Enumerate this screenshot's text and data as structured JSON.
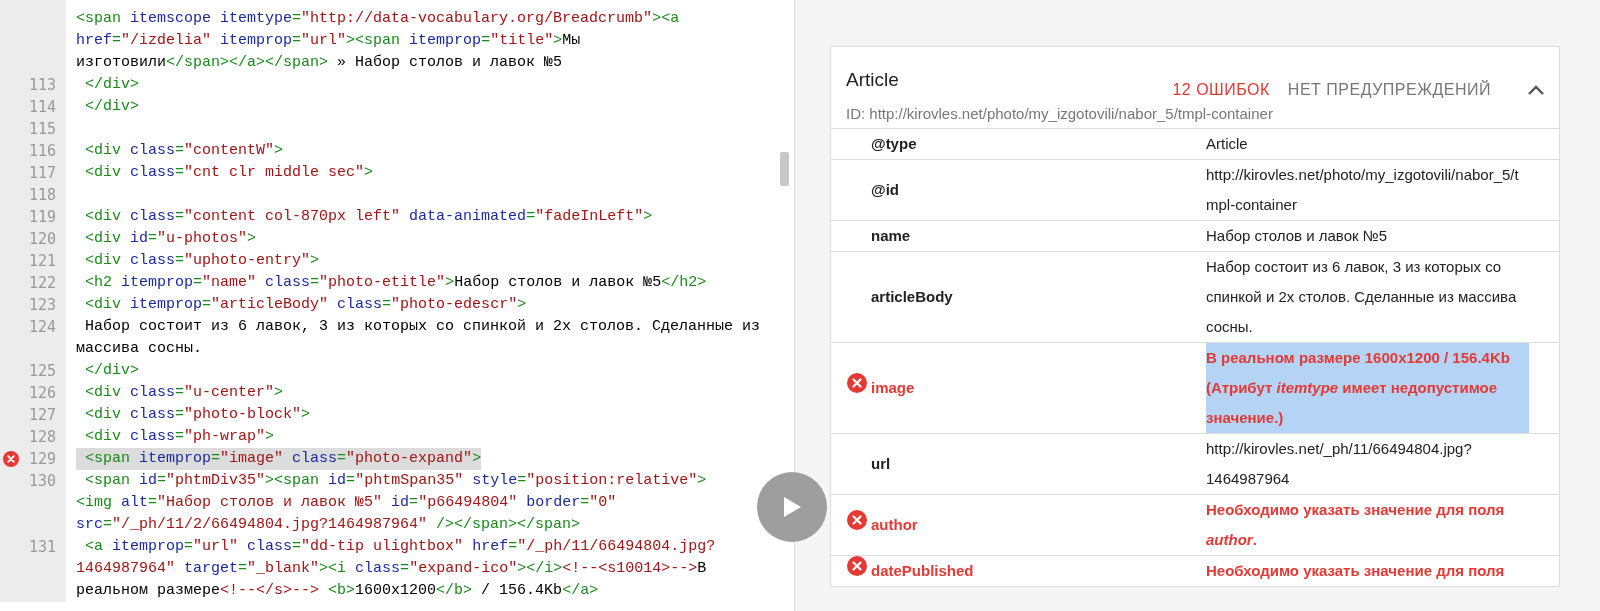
{
  "code": {
    "lines": [
      {
        "error": false,
        "highlighted": false,
        "rows": [
          {
            "segments": [
              {
                "kind": "tag",
                "text": "<span "
              },
              {
                "kind": "attr",
                "text": "itemscope itemtype"
              },
              {
                "kind": "tag",
                "text": "="
              },
              {
                "kind": "val",
                "text": "\"http://data-vocabulary.org/Breadcrumb\""
              },
              {
                "kind": "tag",
                "text": "><a"
              }
            ]
          },
          {
            "segments": [
              {
                "kind": "attr",
                "text": "href"
              },
              {
                "kind": "tag",
                "text": "="
              },
              {
                "kind": "val",
                "text": "\"/izdelia\""
              },
              {
                "kind": "attr",
                "text": " itemprop"
              },
              {
                "kind": "tag",
                "text": "="
              },
              {
                "kind": "val",
                "text": "\"url\""
              },
              {
                "kind": "tag",
                "text": "><span "
              },
              {
                "kind": "attr",
                "text": "itemprop"
              },
              {
                "kind": "tag",
                "text": "="
              },
              {
                "kind": "val",
                "text": "\"title\""
              },
              {
                "kind": "tag",
                "text": ">"
              },
              {
                "kind": "text",
                "text": "Мы"
              }
            ]
          },
          {
            "segments": [
              {
                "kind": "text",
                "text": "изготовили"
              },
              {
                "kind": "tag",
                "text": "</span></a></span>"
              },
              {
                "kind": "text",
                "text": " » Набор столов и лавок №5"
              }
            ]
          }
        ]
      },
      {
        "number": "113",
        "error": false,
        "highlighted": false,
        "rows": [
          {
            "segments": [
              {
                "kind": "tag",
                "text": " </div>"
              }
            ]
          }
        ]
      },
      {
        "number": "114",
        "error": false,
        "highlighted": false,
        "rows": [
          {
            "segments": [
              {
                "kind": "tag",
                "text": " </div>"
              }
            ]
          }
        ]
      },
      {
        "number": "115",
        "error": false,
        "rows": [
          {
            "segments": []
          }
        ]
      },
      {
        "number": "116",
        "error": false,
        "highlighted": false,
        "rows": [
          {
            "segments": [
              {
                "kind": "tag",
                "text": " <div "
              },
              {
                "kind": "attr",
                "text": "class"
              },
              {
                "kind": "tag",
                "text": "="
              },
              {
                "kind": "val",
                "text": "\"contentW\""
              },
              {
                "kind": "tag",
                "text": ">"
              }
            ]
          }
        ]
      },
      {
        "number": "117",
        "error": false,
        "highlighted": false,
        "rows": [
          {
            "segments": [
              {
                "kind": "tag",
                "text": " <div "
              },
              {
                "kind": "attr",
                "text": "class"
              },
              {
                "kind": "tag",
                "text": "="
              },
              {
                "kind": "val",
                "text": "\"cnt clr middle sec\""
              },
              {
                "kind": "tag",
                "text": ">"
              }
            ]
          }
        ]
      },
      {
        "number": "118",
        "error": false,
        "rows": [
          {
            "segments": []
          }
        ]
      },
      {
        "number": "119",
        "error": false,
        "highlighted": false,
        "rows": [
          {
            "segments": [
              {
                "kind": "tag",
                "text": " <div "
              },
              {
                "kind": "attr",
                "text": "class"
              },
              {
                "kind": "tag",
                "text": "="
              },
              {
                "kind": "val",
                "text": "\"content col-870px left\""
              },
              {
                "kind": "attr",
                "text": " data-animated"
              },
              {
                "kind": "tag",
                "text": "="
              },
              {
                "kind": "val",
                "text": "\"fadeInLeft\""
              },
              {
                "kind": "tag",
                "text": ">"
              }
            ]
          }
        ]
      },
      {
        "number": "120",
        "error": false,
        "highlighted": false,
        "rows": [
          {
            "segments": [
              {
                "kind": "tag",
                "text": " <div "
              },
              {
                "kind": "attr",
                "text": "id"
              },
              {
                "kind": "tag",
                "text": "="
              },
              {
                "kind": "val",
                "text": "\"u-photos\""
              },
              {
                "kind": "tag",
                "text": ">"
              }
            ]
          }
        ]
      },
      {
        "number": "121",
        "error": false,
        "highlighted": false,
        "rows": [
          {
            "segments": [
              {
                "kind": "tag",
                "text": " <div "
              },
              {
                "kind": "attr",
                "text": "class"
              },
              {
                "kind": "tag",
                "text": "="
              },
              {
                "kind": "val",
                "text": "\"uphoto-entry\""
              },
              {
                "kind": "tag",
                "text": ">"
              }
            ]
          }
        ]
      },
      {
        "number": "122",
        "error": false,
        "highlighted": false,
        "rows": [
          {
            "segments": [
              {
                "kind": "tag",
                "text": " <h2 "
              },
              {
                "kind": "attr",
                "text": "itemprop"
              },
              {
                "kind": "tag",
                "text": "="
              },
              {
                "kind": "val",
                "text": "\"name\""
              },
              {
                "kind": "attr",
                "text": " class"
              },
              {
                "kind": "tag",
                "text": "="
              },
              {
                "kind": "val",
                "text": "\"photo-etitle\""
              },
              {
                "kind": "tag",
                "text": ">"
              },
              {
                "kind": "text",
                "text": "Набор столов и лавок №5"
              },
              {
                "kind": "tag",
                "text": "</h2>"
              }
            ]
          }
        ]
      },
      {
        "number": "123",
        "error": false,
        "highlighted": false,
        "rows": [
          {
            "segments": [
              {
                "kind": "tag",
                "text": " <div "
              },
              {
                "kind": "attr",
                "text": "itemprop"
              },
              {
                "kind": "tag",
                "text": "="
              },
              {
                "kind": "val",
                "text": "\"articleBody\""
              },
              {
                "kind": "attr",
                "text": " class"
              },
              {
                "kind": "tag",
                "text": "="
              },
              {
                "kind": "val",
                "text": "\"photo-edescr\""
              },
              {
                "kind": "tag",
                "text": ">"
              }
            ]
          }
        ]
      },
      {
        "number": "124",
        "error": false,
        "highlighted": false,
        "rows": [
          {
            "segments": [
              {
                "kind": "text",
                "text": " Набор состоит из 6 лавок, 3 из которых со спинкой и 2х столов. Сделанные из"
              }
            ]
          },
          {
            "segments": [
              {
                "kind": "text",
                "text": "массива сосны."
              }
            ]
          }
        ]
      },
      {
        "number": "125",
        "error": false,
        "highlighted": false,
        "rows": [
          {
            "segments": [
              {
                "kind": "tag",
                "text": " </div>"
              }
            ]
          }
        ]
      },
      {
        "number": "126",
        "error": false,
        "highlighted": false,
        "rows": [
          {
            "segments": [
              {
                "kind": "tag",
                "text": " <div "
              },
              {
                "kind": "attr",
                "text": "class"
              },
              {
                "kind": "tag",
                "text": "="
              },
              {
                "kind": "val",
                "text": "\"u-center\""
              },
              {
                "kind": "tag",
                "text": ">"
              }
            ]
          }
        ]
      },
      {
        "number": "127",
        "error": false,
        "highlighted": false,
        "rows": [
          {
            "segments": [
              {
                "kind": "tag",
                "text": " <div "
              },
              {
                "kind": "attr",
                "text": "class"
              },
              {
                "kind": "tag",
                "text": "="
              },
              {
                "kind": "val",
                "text": "\"photo-block\""
              },
              {
                "kind": "tag",
                "text": ">"
              }
            ]
          }
        ]
      },
      {
        "number": "128",
        "error": false,
        "highlighted": false,
        "rows": [
          {
            "segments": [
              {
                "kind": "tag",
                "text": " <div "
              },
              {
                "kind": "attr",
                "text": "class"
              },
              {
                "kind": "tag",
                "text": "="
              },
              {
                "kind": "val",
                "text": "\"ph-wrap\""
              },
              {
                "kind": "tag",
                "text": ">"
              }
            ]
          }
        ]
      },
      {
        "number": "129",
        "error": true,
        "highlighted": true,
        "rows": [
          {
            "segments": [
              {
                "kind": "tag",
                "text": " <span "
              },
              {
                "kind": "attr",
                "text": "itemprop"
              },
              {
                "kind": "tag",
                "text": "="
              },
              {
                "kind": "val",
                "text": "\"image\""
              },
              {
                "kind": "attr",
                "text": " class"
              },
              {
                "kind": "tag",
                "text": "="
              },
              {
                "kind": "val",
                "text": "\"photo-expand\""
              },
              {
                "kind": "tag",
                "text": ">"
              }
            ]
          }
        ]
      },
      {
        "number": "130",
        "error": false,
        "highlighted": false,
        "rows": [
          {
            "segments": [
              {
                "kind": "tag",
                "text": " <span "
              },
              {
                "kind": "attr",
                "text": "id"
              },
              {
                "kind": "tag",
                "text": "="
              },
              {
                "kind": "val",
                "text": "\"phtmDiv35\""
              },
              {
                "kind": "tag",
                "text": "><span "
              },
              {
                "kind": "attr",
                "text": "id"
              },
              {
                "kind": "tag",
                "text": "="
              },
              {
                "kind": "val",
                "text": "\"phtmSpan35\""
              },
              {
                "kind": "attr",
                "text": " style"
              },
              {
                "kind": "tag",
                "text": "="
              },
              {
                "kind": "val",
                "text": "\"position:relative\""
              },
              {
                "kind": "tag",
                "text": ">"
              }
            ]
          },
          {
            "segments": [
              {
                "kind": "tag",
                "text": "<img "
              },
              {
                "kind": "attr",
                "text": "alt"
              },
              {
                "kind": "tag",
                "text": "="
              },
              {
                "kind": "val",
                "text": "\"Набор столов и лавок №5\""
              },
              {
                "kind": "attr",
                "text": " id"
              },
              {
                "kind": "tag",
                "text": "="
              },
              {
                "kind": "val",
                "text": "\"p66494804\""
              },
              {
                "kind": "attr",
                "text": " border"
              },
              {
                "kind": "tag",
                "text": "="
              },
              {
                "kind": "val",
                "text": "\"0\""
              }
            ]
          },
          {
            "segments": [
              {
                "kind": "attr",
                "text": "src"
              },
              {
                "kind": "tag",
                "text": "="
              },
              {
                "kind": "val",
                "text": "\"/_ph/11/2/66494804.jpg?1464987964\""
              },
              {
                "kind": "tag",
                "text": " /></span></span>"
              }
            ]
          }
        ]
      },
      {
        "number": "131",
        "error": false,
        "highlighted": false,
        "rows": [
          {
            "segments": [
              {
                "kind": "tag",
                "text": " <a "
              },
              {
                "kind": "attr",
                "text": "itemprop"
              },
              {
                "kind": "tag",
                "text": "="
              },
              {
                "kind": "val",
                "text": "\"url\""
              },
              {
                "kind": "attr",
                "text": " class"
              },
              {
                "kind": "tag",
                "text": "="
              },
              {
                "kind": "val",
                "text": "\"dd-tip ulightbox\""
              },
              {
                "kind": "attr",
                "text": " href"
              },
              {
                "kind": "tag",
                "text": "="
              },
              {
                "kind": "val",
                "text": "\"/_ph/11/66494804.jpg?"
              }
            ]
          },
          {
            "segments": [
              {
                "kind": "val",
                "text": "1464987964\""
              },
              {
                "kind": "attr",
                "text": " target"
              },
              {
                "kind": "tag",
                "text": "="
              },
              {
                "kind": "val",
                "text": "\"_blank\""
              },
              {
                "kind": "tag",
                "text": "><i "
              },
              {
                "kind": "attr",
                "text": "class"
              },
              {
                "kind": "tag",
                "text": "="
              },
              {
                "kind": "val",
                "text": "\"expand-ico\""
              },
              {
                "kind": "tag",
                "text": "></i>"
              },
              {
                "kind": "val",
                "text": "<!--<s10014>-->"
              },
              {
                "kind": "text",
                "text": "В"
              }
            ]
          },
          {
            "segments": [
              {
                "kind": "text",
                "text": "реальном размере"
              },
              {
                "kind": "val",
                "text": "<!--</s>-->"
              },
              {
                "kind": "tag",
                "text": " <b>"
              },
              {
                "kind": "text",
                "text": "1600x1200"
              },
              {
                "kind": "tag",
                "text": "</b>"
              },
              {
                "kind": "text",
                "text": " / 156.4Kb"
              },
              {
                "kind": "tag",
                "text": "</a>"
              }
            ]
          }
        ]
      }
    ]
  },
  "result": {
    "title": "Article",
    "errors": "12 ОШИБОК",
    "warnings": "НЕТ ПРЕДУПРЕЖДЕНИЙ",
    "expanded": true,
    "id": "ID: http://kirovles.net/photo/my_izgotovili/nabor_5/tmpl-container",
    "properties": [
      {
        "name": "@type",
        "value": "Article",
        "error": false,
        "highlighted": false
      },
      {
        "name": "@id",
        "value": "http://kirovles.net/photo/my_izgotovili/nabor_5/tmpl-container",
        "error": false,
        "highlighted": false
      },
      {
        "name": "name",
        "value": "Набор столов и лавок №5",
        "error": false,
        "highlighted": false
      },
      {
        "name": "articleBody",
        "value": "Набор состоит из 6 лавок, 3 из которых со спинкой и 2х столов. Сделанные из массива сосны.",
        "error": false,
        "highlighted": false
      },
      {
        "name": "image",
        "value": "В реальном размере 1600x1200 / 156.4Kb (Атрибут *itemtype* имеет недопустимое значение.)",
        "error": true,
        "highlighted": true
      },
      {
        "name": "url",
        "value": "http://kirovles.net/_ph/11/66494804.jpg?1464987964",
        "error": false,
        "highlighted": false
      },
      {
        "name": "author",
        "value": "Необходимо указать значение для поля *author*.",
        "error": true,
        "highlighted": false
      },
      {
        "name": "datePublished",
        "value": "Необходимо указать значение для поля",
        "error": true,
        "highlighted": false
      }
    ]
  }
}
